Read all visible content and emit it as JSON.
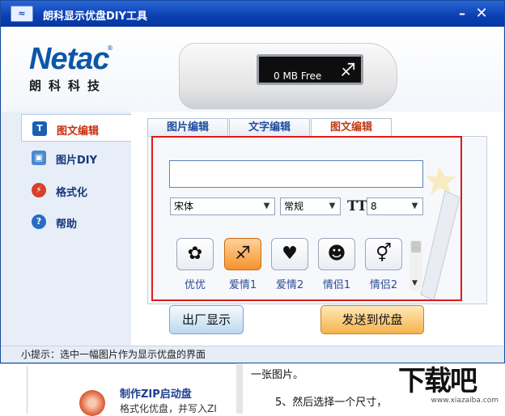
{
  "window": {
    "title": "朗科显示优盘DIY工具"
  },
  "titlebar": {
    "minimize_glyph": "–",
    "close_glyph": "✕"
  },
  "logo": {
    "brand": "Netac",
    "registered": "®",
    "subtitle": "朗科科技"
  },
  "usb": {
    "free_space": "0 MB Free"
  },
  "sidebar": {
    "items": [
      {
        "label": "图文编辑",
        "icon": "text-image-edit-icon",
        "active": true,
        "color": "#1c5fb0"
      },
      {
        "label": "图片DIY",
        "icon": "picture-icon",
        "active": false,
        "color": "#4a8ad0"
      },
      {
        "label": "格式化",
        "icon": "format-lightning-icon",
        "active": false,
        "color": "#d8402a"
      },
      {
        "label": "帮助",
        "icon": "help-icon",
        "active": false,
        "color": "#2a6cc4"
      }
    ]
  },
  "tabs": [
    {
      "label": "图片编辑",
      "active": false
    },
    {
      "label": "文字编辑",
      "active": false
    },
    {
      "label": "图文编辑",
      "active": true
    }
  ],
  "editor": {
    "text_value": "",
    "font": "宋体",
    "style": "常规",
    "size": "8",
    "images": [
      {
        "label": "优优",
        "icon": "bee-icon",
        "selected": false
      },
      {
        "label": "爱情1",
        "icon": "cupid-icon",
        "selected": true
      },
      {
        "label": "爱情2",
        "icon": "heart-icon",
        "selected": false
      },
      {
        "label": "情侣1",
        "icon": "couple-icon",
        "selected": false
      },
      {
        "label": "情侣2",
        "icon": "gender-symbol-icon",
        "selected": false
      }
    ]
  },
  "buttons": {
    "factory_display": "出厂显示",
    "send_to_usb": "发送到优盘"
  },
  "hint": "小提示：选中一幅图片作为显示优盘的界面",
  "background": {
    "left_heading": "制作ZIP启动盘",
    "left_desc": "格式化优盘，并写入ZI",
    "right_line1": "一张图片。",
    "right_line2": "5、然后选择一个尺寸，",
    "watermark_text": "下载吧",
    "watermark_url": "www.xiazaiba.com"
  }
}
